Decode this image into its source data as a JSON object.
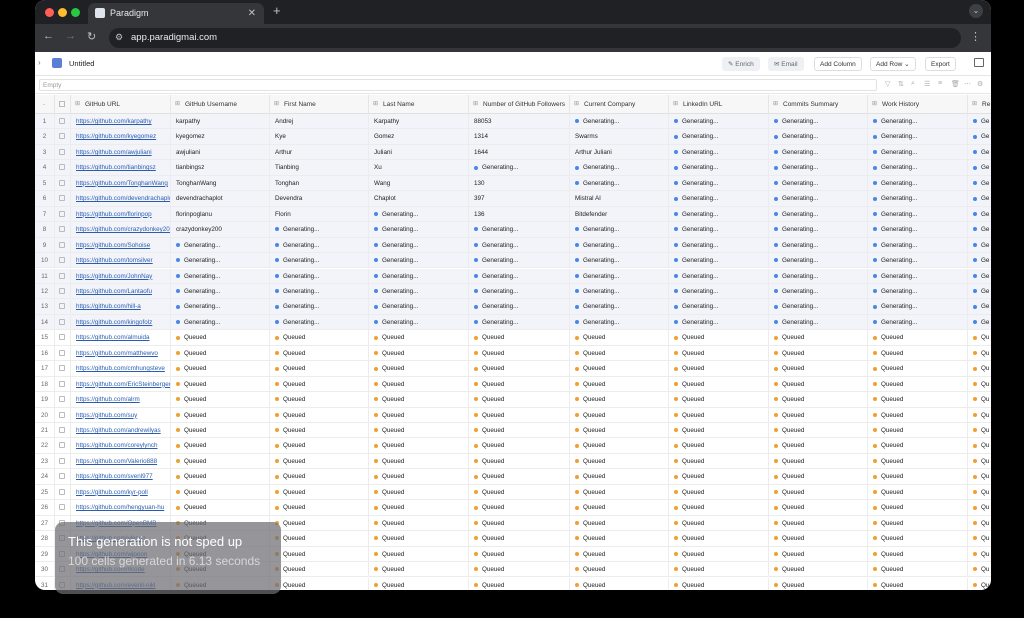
{
  "browser": {
    "tab_title": "Paradigm",
    "url": "app.paradigmai.com"
  },
  "app": {
    "doc_title": "Untitled",
    "buttons": {
      "enrich": "Enrich",
      "email": "Email",
      "add_column": "Add Column",
      "add_row": "Add Row",
      "export": "Export"
    },
    "filter_placeholder": "Empty"
  },
  "columns": [
    "GitHub URL",
    "GitHub Username",
    "First Name",
    "Last Name",
    "Number of GitHub Followers",
    "Current Company",
    "LinkedIn URL",
    "Commits Summary",
    "Work History",
    "Re"
  ],
  "rows": [
    {
      "n": "1",
      "url": "https://github.com/karpathy",
      "user": "karpathy",
      "first": "Andrej",
      "last": "Karpathy",
      "foll": "88053",
      "comp": "Generating...",
      "li": "Generating...",
      "commits": "Generating...",
      "work": "Generating...",
      "re": "Ge"
    },
    {
      "n": "2",
      "url": "https://github.com/kyegomez",
      "user": "kyegomez",
      "first": "Kye",
      "last": "Gomez",
      "foll": "1314",
      "comp": "Swarms",
      "li": "Generating...",
      "commits": "Generating...",
      "work": "Generating...",
      "re": "Ge"
    },
    {
      "n": "3",
      "url": "https://github.com/awjuliani",
      "user": "awjuliani",
      "first": "Arthur",
      "last": "Juliani",
      "foll": "1644",
      "comp": "Arthur Juliani",
      "li": "Generating...",
      "commits": "Generating...",
      "work": "Generating...",
      "re": "Ge"
    },
    {
      "n": "4",
      "url": "https://github.com/tianbingsz",
      "user": "tianbingsz",
      "first": "Tianbing",
      "last": "Xu",
      "foll": "Generating...",
      "comp": "Generating...",
      "li": "Generating...",
      "commits": "Generating...",
      "work": "Generating...",
      "re": "Ge"
    },
    {
      "n": "5",
      "url": "https://github.com/TonghanWang",
      "user": "TonghanWang",
      "first": "Tonghan",
      "last": "Wang",
      "foll": "130",
      "comp": "Generating...",
      "li": "Generating...",
      "commits": "Generating...",
      "work": "Generating...",
      "re": "Ge"
    },
    {
      "n": "6",
      "url": "https://github.com/devendrachaplot",
      "user": "devendrachaplot",
      "first": "Devendra",
      "last": "Chaplot",
      "foll": "397",
      "comp": "Mistral AI",
      "li": "Generating...",
      "commits": "Generating...",
      "work": "Generating...",
      "re": "Ge"
    },
    {
      "n": "7",
      "url": "https://github.com/florinpop",
      "user": "florinpoglanu",
      "first": "Florin",
      "last": "Generating...",
      "foll": "136",
      "comp": "Bitdefender",
      "li": "Generating...",
      "commits": "Generating...",
      "work": "Generating...",
      "re": "Ge"
    },
    {
      "n": "8",
      "url": "https://github.com/crazydonkey200",
      "user": "crazydonkey200",
      "first": "Generating...",
      "last": "Generating...",
      "foll": "Generating...",
      "comp": "Generating...",
      "li": "Generating...",
      "commits": "Generating...",
      "work": "Generating...",
      "re": "Ge"
    },
    {
      "n": "9",
      "url": "https://github.com/Sohoise",
      "user": "Generating...",
      "first": "Generating...",
      "last": "Generating...",
      "foll": "Generating...",
      "comp": "Generating...",
      "li": "Generating...",
      "commits": "Generating...",
      "work": "Generating...",
      "re": "Ge"
    },
    {
      "n": "10",
      "url": "https://github.com/tomsilver",
      "user": "Generating...",
      "first": "Generating...",
      "last": "Generating...",
      "foll": "Generating...",
      "comp": "Generating...",
      "li": "Generating...",
      "commits": "Generating...",
      "work": "Generating...",
      "re": "Ge"
    },
    {
      "n": "11",
      "url": "https://github.com/JohnNay",
      "user": "Generating...",
      "first": "Generating...",
      "last": "Generating...",
      "foll": "Generating...",
      "comp": "Generating...",
      "li": "Generating...",
      "commits": "Generating...",
      "work": "Generating...",
      "re": "Ge"
    },
    {
      "n": "12",
      "url": "https://github.com/Lantaofu",
      "user": "Generating...",
      "first": "Generating...",
      "last": "Generating...",
      "foll": "Generating...",
      "comp": "Generating...",
      "li": "Generating...",
      "commits": "Generating...",
      "work": "Generating...",
      "re": "Ge"
    },
    {
      "n": "13",
      "url": "https://github.com/hill-a",
      "user": "Generating...",
      "first": "Generating...",
      "last": "Generating...",
      "foll": "Generating...",
      "comp": "Generating...",
      "li": "Generating...",
      "commits": "Generating...",
      "work": "Generating...",
      "re": "Ge"
    },
    {
      "n": "14",
      "url": "https://github.com/kingofolz",
      "user": "Generating...",
      "first": "Generating...",
      "last": "Generating...",
      "foll": "Generating...",
      "comp": "Generating...",
      "li": "Generating...",
      "commits": "Generating...",
      "work": "Generating...",
      "re": "Ge"
    },
    {
      "n": "15",
      "url": "https://github.com/almuida",
      "user": "Queued",
      "first": "Queued",
      "last": "Queued",
      "foll": "Queued",
      "comp": "Queued",
      "li": "Queued",
      "commits": "Queued",
      "work": "Queued",
      "re": "Qu"
    },
    {
      "n": "16",
      "url": "https://github.com/matthewvo",
      "user": "Queued",
      "first": "Queued",
      "last": "Queued",
      "foll": "Queued",
      "comp": "Queued",
      "li": "Queued",
      "commits": "Queued",
      "work": "Queued",
      "re": "Qu"
    },
    {
      "n": "17",
      "url": "https://github.com/cmhungsteve",
      "user": "Queued",
      "first": "Queued",
      "last": "Queued",
      "foll": "Queued",
      "comp": "Queued",
      "li": "Queued",
      "commits": "Queued",
      "work": "Queued",
      "re": "Qu"
    },
    {
      "n": "18",
      "url": "https://github.com/EricSteinberger",
      "user": "Queued",
      "first": "Queued",
      "last": "Queued",
      "foll": "Queued",
      "comp": "Queued",
      "li": "Queued",
      "commits": "Queued",
      "work": "Queued",
      "re": "Qu"
    },
    {
      "n": "19",
      "url": "https://github.com/alrm",
      "user": "Queued",
      "first": "Queued",
      "last": "Queued",
      "foll": "Queued",
      "comp": "Queued",
      "li": "Queued",
      "commits": "Queued",
      "work": "Queued",
      "re": "Qu"
    },
    {
      "n": "20",
      "url": "https://github.com/suy",
      "user": "Queued",
      "first": "Queued",
      "last": "Queued",
      "foll": "Queued",
      "comp": "Queued",
      "li": "Queued",
      "commits": "Queued",
      "work": "Queued",
      "re": "Qu"
    },
    {
      "n": "21",
      "url": "https://github.com/andrewilyas",
      "user": "Queued",
      "first": "Queued",
      "last": "Queued",
      "foll": "Queued",
      "comp": "Queued",
      "li": "Queued",
      "commits": "Queued",
      "work": "Queued",
      "re": "Qu"
    },
    {
      "n": "22",
      "url": "https://github.com/coreylynch",
      "user": "Queued",
      "first": "Queued",
      "last": "Queued",
      "foll": "Queued",
      "comp": "Queued",
      "li": "Queued",
      "commits": "Queued",
      "work": "Queued",
      "re": "Qu"
    },
    {
      "n": "23",
      "url": "https://github.com/Valerio888",
      "user": "Queued",
      "first": "Queued",
      "last": "Queued",
      "foll": "Queued",
      "comp": "Queued",
      "li": "Queued",
      "commits": "Queued",
      "work": "Queued",
      "re": "Qu"
    },
    {
      "n": "24",
      "url": "https://github.com/svenl977",
      "user": "Queued",
      "first": "Queued",
      "last": "Queued",
      "foll": "Queued",
      "comp": "Queued",
      "li": "Queued",
      "commits": "Queued",
      "work": "Queued",
      "re": "Qu"
    },
    {
      "n": "25",
      "url": "https://github.com/kyr-poll",
      "user": "Queued",
      "first": "Queued",
      "last": "Queued",
      "foll": "Queued",
      "comp": "Queued",
      "li": "Queued",
      "commits": "Queued",
      "work": "Queued",
      "re": "Qu"
    },
    {
      "n": "26",
      "url": "https://github.com/hengyuan-hu",
      "user": "Queued",
      "first": "Queued",
      "last": "Queued",
      "foll": "Queued",
      "comp": "Queued",
      "li": "Queued",
      "commits": "Queued",
      "work": "Queued",
      "re": "Qu"
    },
    {
      "n": "27",
      "url": "https://github.com/OpenBMB",
      "user": "Queued",
      "first": "Queued",
      "last": "Queued",
      "foll": "Queued",
      "comp": "Queued",
      "li": "Queued",
      "commits": "Queued",
      "work": "Queued",
      "re": "Qu"
    },
    {
      "n": "28",
      "url": "https://github.com/ylecun",
      "user": "Queued",
      "first": "Queued",
      "last": "Queued",
      "foll": "Queued",
      "comp": "Queued",
      "li": "Queued",
      "commits": "Queued",
      "work": "Queued",
      "re": "Qu"
    },
    {
      "n": "29",
      "url": "https://github.com/wjpoon",
      "user": "Queued",
      "first": "Queued",
      "last": "Queued",
      "foll": "Queued",
      "comp": "Queued",
      "li": "Queued",
      "commits": "Queued",
      "work": "Queued",
      "re": "Qu"
    },
    {
      "n": "30",
      "url": "https://github.com/rlcode",
      "user": "Queued",
      "first": "Queued",
      "last": "Queued",
      "foll": "Queued",
      "comp": "Queued",
      "li": "Queued",
      "commits": "Queued",
      "work": "Queued",
      "re": "Qu"
    },
    {
      "n": "31",
      "url": "https://github.com/evenli-nikl",
      "user": "Queued",
      "first": "Queued",
      "last": "Queued",
      "foll": "Queued",
      "comp": "Queued",
      "li": "Queued",
      "commits": "Queued",
      "work": "Queued",
      "re": "Qu"
    }
  ],
  "overlay": {
    "line1": "This generation is not sped up",
    "line2": "100 cells generated in 6.13 seconds"
  },
  "colors": {
    "generating_dot": "#4a86e8",
    "queued_dot": "#f0a030",
    "link": "#2a5db0"
  }
}
